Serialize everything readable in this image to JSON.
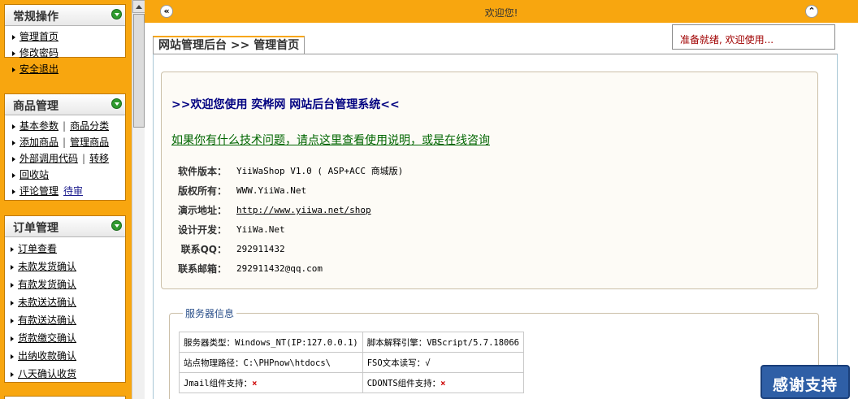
{
  "sidebar": {
    "panels": [
      {
        "title": "常规操作",
        "items": [
          {
            "links": [
              "管理首页"
            ]
          },
          {
            "links": [
              "修改密码"
            ]
          },
          {
            "links": [
              "安全退出"
            ]
          }
        ]
      },
      {
        "title": "商品管理",
        "items": [
          {
            "links": [
              "基本参数",
              "商品分类"
            ]
          },
          {
            "links": [
              "添加商品",
              "管理商品"
            ]
          },
          {
            "links": [
              "外部调用代码",
              "转移"
            ]
          },
          {
            "links": [
              "回收站"
            ]
          },
          {
            "links": [
              "评论管理",
              "待审"
            ]
          }
        ]
      },
      {
        "title": "订单管理",
        "items": [
          {
            "links": [
              "订单查看"
            ]
          },
          {
            "links": [
              "未款发货确认"
            ]
          },
          {
            "links": [
              "有款发货确认"
            ]
          },
          {
            "links": [
              "未款送达确认"
            ]
          },
          {
            "links": [
              "有款送达确认"
            ]
          },
          {
            "links": [
              "货款缴交确认"
            ]
          },
          {
            "links": [
              "出纳收款确认"
            ]
          },
          {
            "links": [
              "八天确认收货"
            ]
          }
        ]
      }
    ],
    "separator": "|"
  },
  "topbar": {
    "welcome": "欢迎您!",
    "collapse_icon": "double-chevron-left",
    "up_icon": "double-chevron-up"
  },
  "tab": {
    "label": "网站管理后台 >> 管理首页"
  },
  "status": {
    "text": "准备就绪, 欢迎使用..."
  },
  "welcome_box": {
    "heading": ">>欢迎您使用 奕桦网 网站后台管理系统<<",
    "help_link": "如果你有什么技术问题，请点这里查看使用说明，或是在线咨询",
    "info": [
      {
        "label": "软件版本：",
        "value": "YiiWaShop V1.0 ( ASP+ACC 商城版)",
        "link": false
      },
      {
        "label": "版权所有：",
        "value": "WWW.YiiWa.Net",
        "link": false
      },
      {
        "label": "演示地址：",
        "value": "http://www.yiiwa.net/shop",
        "link": true
      },
      {
        "label": "设计开发：",
        "value": "YiiWa.Net",
        "link": false
      },
      {
        "label": "联系QQ：",
        "value": "292911432",
        "link": false
      },
      {
        "label": "联系邮箱：",
        "value": "292911432@qq.com",
        "link": false
      }
    ]
  },
  "server": {
    "legend": "服务器信息",
    "rows": [
      [
        {
          "label": "服务器类型：",
          "value": "Windows_NT(IP:127.0.0.1)"
        },
        {
          "label": "脚本解释引擎：",
          "value": "VBScript/5.7.18066"
        }
      ],
      [
        {
          "label": "站点物理路径：",
          "value": "C:\\PHPnow\\htdocs\\"
        },
        {
          "label": "FSO文本读写：",
          "value": "√"
        }
      ],
      [
        {
          "label": "Jmail组件支持：",
          "value": "×"
        },
        {
          "label": "CDONTS组件支持：",
          "value": "×"
        }
      ]
    ]
  },
  "support": {
    "label": "感谢支持"
  },
  "colors": {
    "accent": "#f8a60f",
    "heading": "#000080",
    "help_link": "#006600",
    "status": "#a00000",
    "badge": "#2f5fa6"
  }
}
